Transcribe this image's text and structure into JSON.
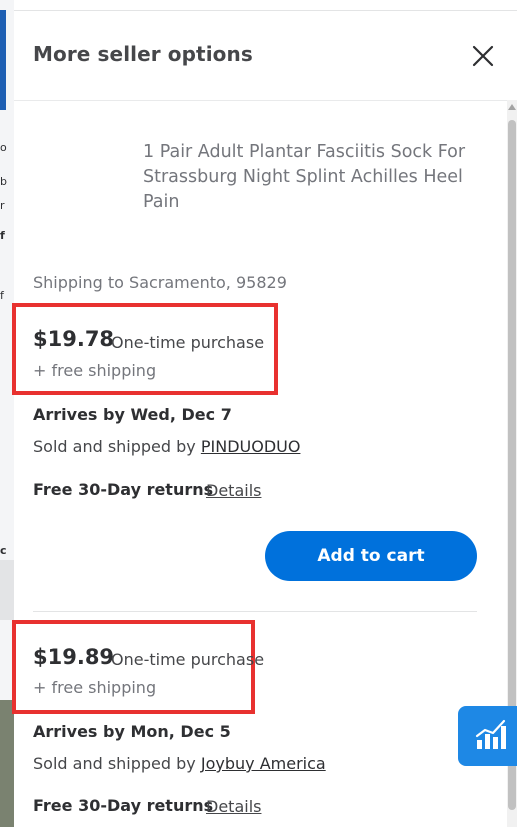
{
  "panel": {
    "title": "More seller options"
  },
  "product": {
    "title": "1 Pair Adult Plantar Fasciitis Sock For Strassburg Night Splint Achilles Heel Pain",
    "shipping_to": "Shipping to Sacramento, 95829"
  },
  "offers": [
    {
      "price": "$19.78",
      "purchase_type": "One-time purchase",
      "shipping": "+ free shipping",
      "arrives": "Arrives by Wed, Dec 7",
      "sold_prefix": "Sold and shipped by ",
      "seller": "PINDUODUO",
      "returns": "Free 30-Day returns",
      "details": "Details",
      "add_to_cart": "Add to cart"
    },
    {
      "price": "$19.89",
      "purchase_type": "One-time purchase",
      "shipping": "+ free shipping",
      "arrives": "Arrives by Mon, Dec 5",
      "sold_prefix": "Sold and shipped by ",
      "seller": "Joybuy America",
      "returns": "Free 30-Day returns",
      "details": "Details"
    }
  ],
  "icons": {
    "close": "close-icon",
    "chart": "bar-chart-icon"
  },
  "colors": {
    "primary": "#0071dc",
    "highlight": "#e8312f",
    "fab": "#1e88e5"
  }
}
